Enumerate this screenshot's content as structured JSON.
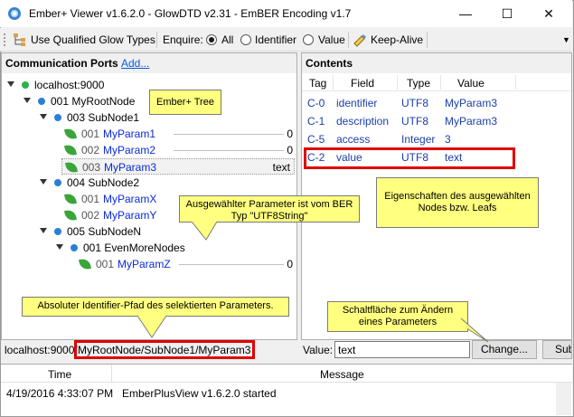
{
  "window": {
    "title": "Ember+ Viewer v1.6.2.0 - GlowDTD v2.31 - EmBER Encoding v1.7",
    "min_glyph": "—",
    "max_glyph": "☐",
    "close_glyph": "✕"
  },
  "toolbar": {
    "use_qualified": "Use Qualified Glow Types",
    "enquire_label": "Enquire:",
    "opt_all": "All",
    "opt_identifier": "Identifier",
    "opt_value": "Value",
    "keep_alive": "Keep-Alive",
    "selected_enquire": "All"
  },
  "left_panel": {
    "title": "Communication Ports",
    "add_link": "Add...",
    "tree": {
      "root": "localhost:9000",
      "node1": "001 MyRootNode",
      "subnode1": "003 SubNode1",
      "p1_num": "001",
      "p1_name": "MyParam1",
      "p1_val": "0",
      "p2_num": "002",
      "p2_name": "MyParam2",
      "p2_val": "0",
      "p3_num": "003",
      "p3_name": "MyParam3",
      "p3_val": "text",
      "subnode2": "004 SubNode2",
      "px_num": "001",
      "px_name": "MyParamX",
      "py_num": "002",
      "py_name": "MyParamY",
      "subnodeN": "005 SubNodeN",
      "evenmore": "001 EvenMoreNodes",
      "pz_num": "001",
      "pz_name": "MyParamZ",
      "pz_val": "0"
    },
    "path_prefix": "localhost:9000/",
    "path_selected": "MyRootNode/SubNode1/MyParam3"
  },
  "right_panel": {
    "title": "Contents",
    "columns": [
      "Tag",
      "Field",
      "Type",
      "Value"
    ],
    "rows": [
      [
        "C-0",
        "identifier",
        "UTF8",
        "MyParam3"
      ],
      [
        "C-1",
        "description",
        "UTF8",
        "MyParam3"
      ],
      [
        "C-5",
        "access",
        "Integer",
        "3"
      ],
      [
        "C-2",
        "value",
        "UTF8",
        "text"
      ]
    ],
    "value_label": "Value:",
    "value_input": "text",
    "change_button": "Change...",
    "sub_button": "Sub"
  },
  "log": {
    "col_time": "Time",
    "col_message": "Message",
    "row_time": "4/19/2016 4:33:07 PM",
    "row_message": "EmberPlusView v1.6.2.0 started"
  },
  "annotations": {
    "tree": "Ember+ Tree",
    "param_type": "Ausgewählter Parameter ist vom BER Typ \"UTF8String\"",
    "properties": "Eigenschaften des ausgewählten Nodes bzw. Leafs",
    "path": "Absoluter Identifier-Pfad des selektierten Parameters.",
    "change": "Schaltfläche zum Ändern eines Parameters"
  },
  "colors": {
    "annotation_fill": "#ffff80",
    "highlight_red": "#e00000",
    "param_blue": "#0a2ad6",
    "online_green": "#2db34a",
    "node_blue": "#2b7fd8"
  }
}
